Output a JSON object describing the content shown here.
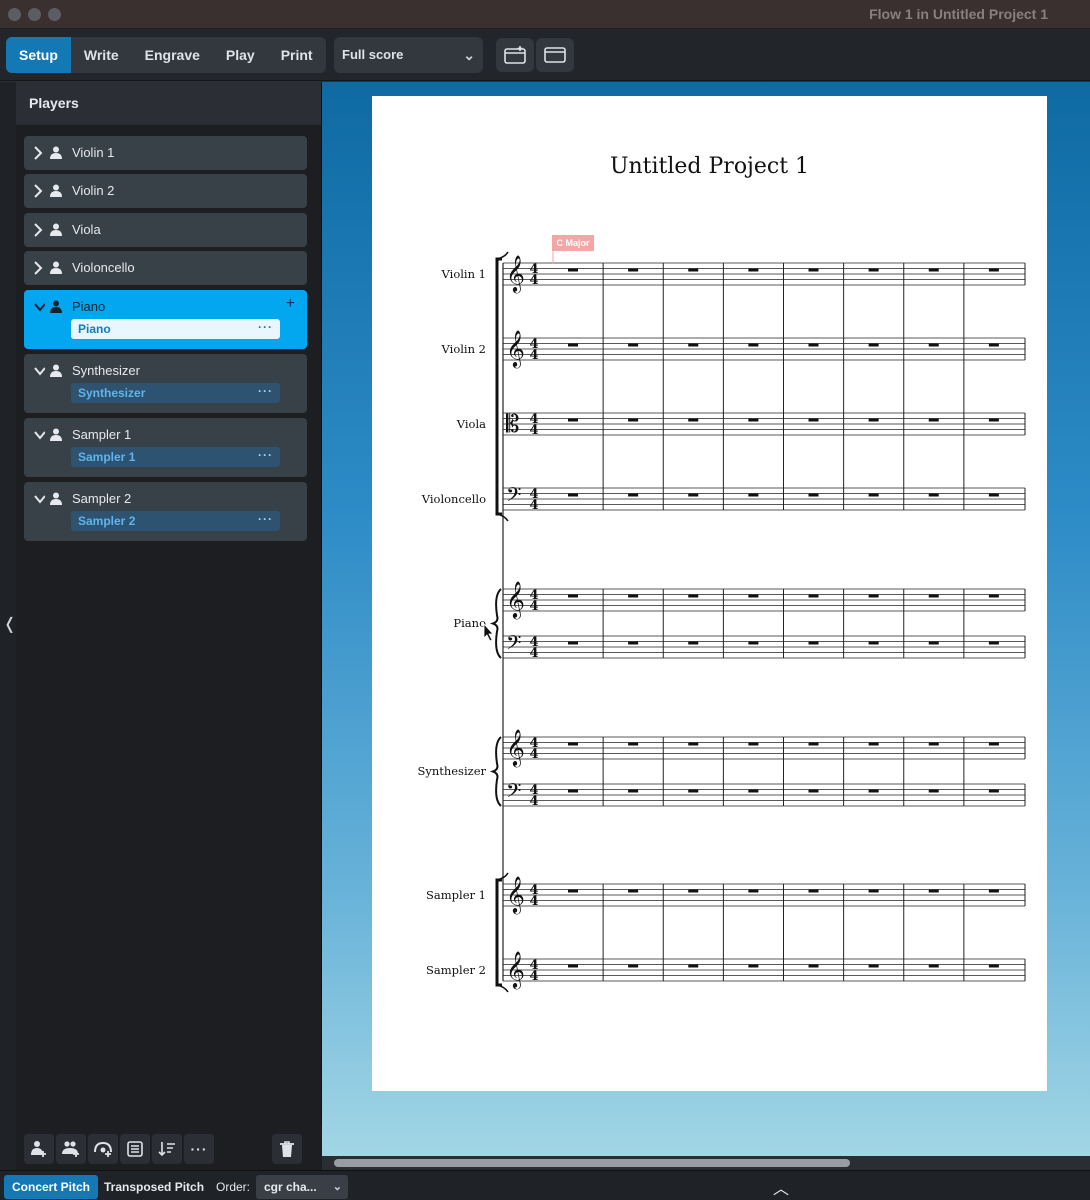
{
  "window": {
    "title": "Flow 1 in Untitled Project 1"
  },
  "toolbar": {
    "modes": [
      "Setup",
      "Write",
      "Engrave",
      "Play",
      "Print"
    ],
    "active_mode": "Setup",
    "layout_select": "Full score"
  },
  "panel": {
    "title": "Players",
    "players": [
      {
        "name": "Violin 1",
        "expanded": false
      },
      {
        "name": "Violin 2",
        "expanded": false
      },
      {
        "name": "Viola",
        "expanded": false
      },
      {
        "name": "Violoncello",
        "expanded": false
      },
      {
        "name": "Piano",
        "expanded": true,
        "instrument": "Piano",
        "selected": true
      },
      {
        "name": "Synthesizer",
        "expanded": true,
        "instrument": "Synthesizer"
      },
      {
        "name": "Sampler 1",
        "expanded": true,
        "instrument": "Sampler 1"
      },
      {
        "name": "Sampler 2",
        "expanded": true,
        "instrument": "Sampler 2"
      }
    ],
    "instrument_menu": "···"
  },
  "score": {
    "title": "Untitled Project 1",
    "key_signpost": "C Major",
    "staff_labels": [
      "Violin 1",
      "Violin 2",
      "Viola",
      "Violoncello",
      "Piano",
      "Synthesizer",
      "Sampler 1",
      "Sampler 2"
    ],
    "measures": 8,
    "time_signature": "4/4"
  },
  "statusbar": {
    "concert_pitch": "Concert Pitch",
    "transposed_pitch": "Transposed Pitch",
    "order_label": "Order:",
    "order_value": "cgr cha..."
  },
  "colors": {
    "accent": "#1478b4",
    "selected_player": "#02a7ef"
  }
}
